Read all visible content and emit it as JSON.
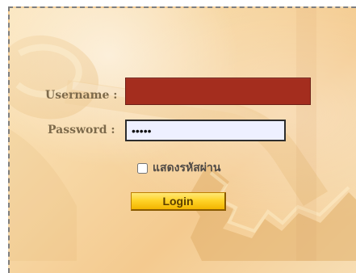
{
  "login_form": {
    "username_label": "Username :",
    "username_value": "",
    "password_label": "Password :",
    "password_value": "•••••",
    "show_password_label": "แสดงรหัสผ่าน",
    "show_password_checked": false,
    "login_button_label": "Login"
  },
  "colors": {
    "background": "#f7d7a4",
    "username_field": "#a42d1e",
    "password_field": "#eef0ff",
    "button": "#ffd42a",
    "label_text": "#7d6a4b"
  }
}
